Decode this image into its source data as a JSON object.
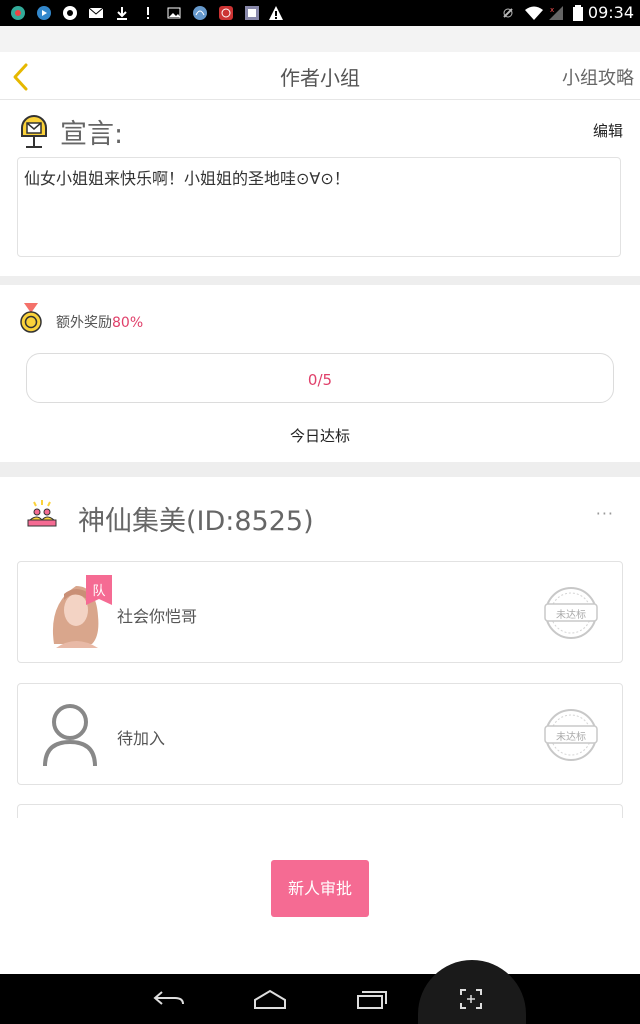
{
  "status_bar": {
    "time": "09:34"
  },
  "header": {
    "title": "作者小组",
    "guide_link": "小组攻略"
  },
  "manifesto": {
    "heading": "宣言:",
    "edit_label": "编辑",
    "text": "仙女小姐姐来快乐啊！小姐姐的圣地哇⊙∀⊙！"
  },
  "reward": {
    "label": "额外奖励",
    "percent": "80%"
  },
  "progress": {
    "text": "0/5",
    "caption": "今日达标"
  },
  "team": {
    "name": "神仙集美(ID:8525)",
    "more": "···",
    "members": [
      {
        "name": "社会你恺哥",
        "badge": "队",
        "stamp": "未达标"
      },
      {
        "name": "待加入",
        "stamp": "未达标"
      }
    ]
  },
  "actions": {
    "approve_label": "新人审批"
  },
  "colors": {
    "accent": "#f56b93",
    "highlight": "#e0406a"
  }
}
